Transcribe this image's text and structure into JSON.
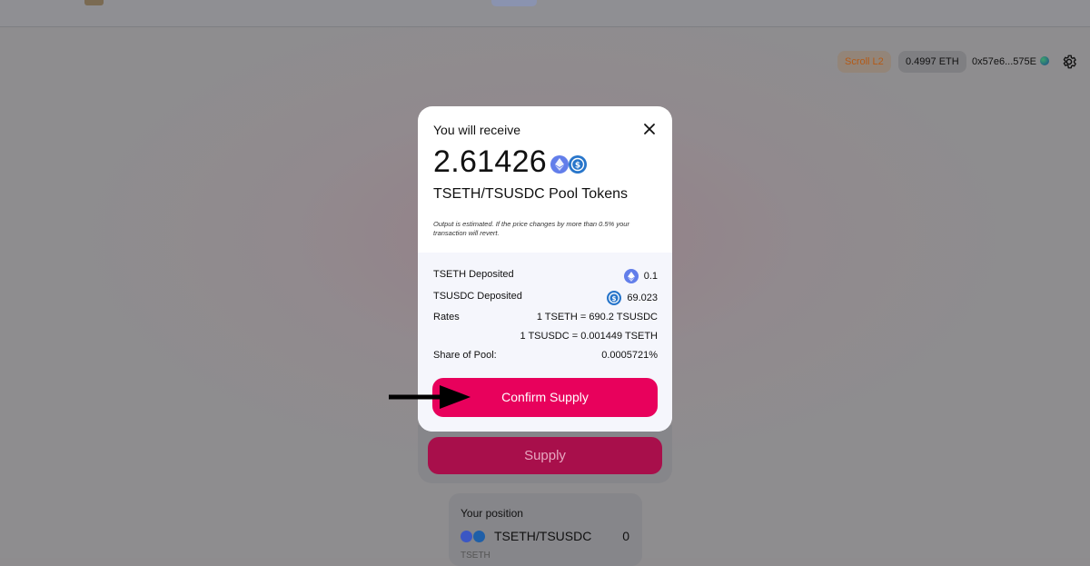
{
  "header": {
    "network": "Scroll L2",
    "balance": "0.4997 ETH",
    "address": "0x57e6...575E"
  },
  "modal": {
    "title": "You will receive",
    "amount": "2.61426",
    "pool_tokens": "TSETH/TSUSDC Pool Tokens",
    "note": "Output is estimated. If the price changes by more than 0.5% your transaction will revert.",
    "rows": [
      {
        "label": "TSETH Deposited",
        "value": "0.1",
        "icon": "eth-icon"
      },
      {
        "label": "TSUSDC Deposited",
        "value": "69.023",
        "icon": "usdc-icon"
      },
      {
        "label": "Rates",
        "value": "1 TSETH = 690.2 TSUSDC"
      },
      {
        "label": "",
        "value": "1 TSUSDC = 0.001449 TSETH"
      },
      {
        "label": "Share of Pool:",
        "value": "0.0005721%"
      }
    ],
    "confirm_label": "Confirm Supply"
  },
  "background": {
    "supply_label": "Supply",
    "position_title": "Your position",
    "position_pair": "TSETH/TSUSDC",
    "position_value": "0",
    "position_sub": "TSETH"
  },
  "colors": {
    "accent": "#e8015c",
    "eth": "#627eea",
    "usdc": "#2775ca",
    "network_text": "#b45a16"
  }
}
